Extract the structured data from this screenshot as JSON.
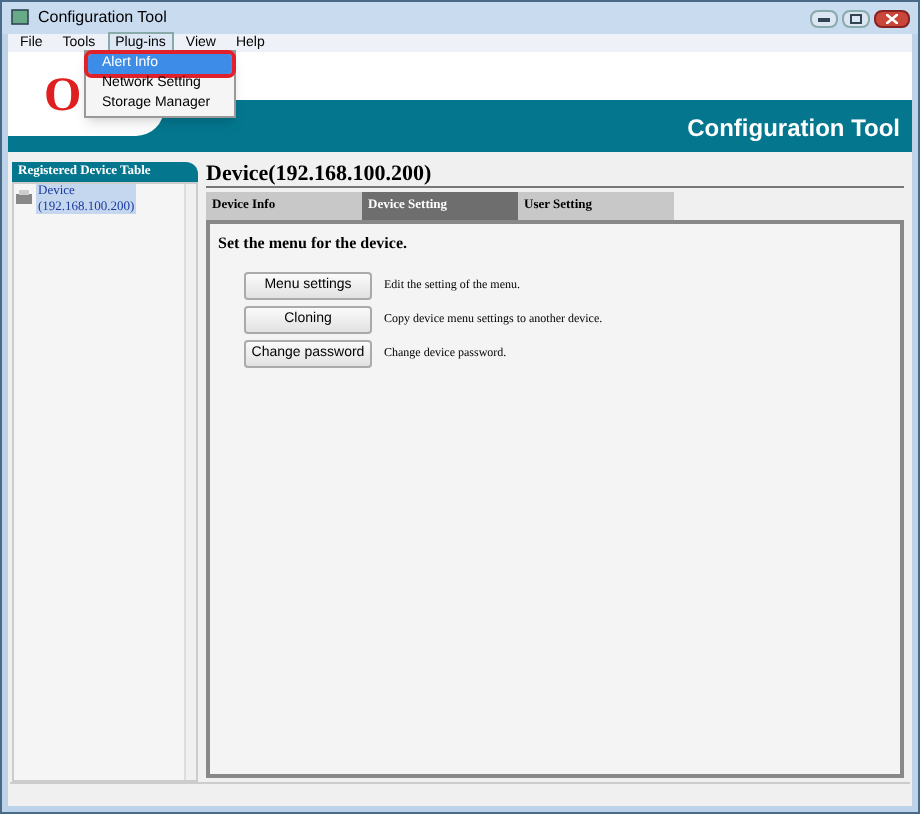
{
  "window": {
    "title": "Configuration Tool"
  },
  "menu_bar": [
    {
      "label": "File",
      "selected": false
    },
    {
      "label": "Tools",
      "selected": false
    },
    {
      "label": "Plug-ins",
      "selected": true
    },
    {
      "label": "View",
      "selected": false
    },
    {
      "label": "Help",
      "selected": false
    }
  ],
  "dropdown": [
    {
      "label": "Alert Info",
      "selected": true
    },
    {
      "label": "Network Setting",
      "selected": false
    },
    {
      "label": "Storage Manager",
      "selected": false
    }
  ],
  "header": {
    "logo": "O",
    "title": "Configuration Tool"
  },
  "sidebar": {
    "title": "Registered Device Table",
    "items": [
      {
        "name": "Device",
        "address": "(192.168.100.200)",
        "selected": true
      }
    ]
  },
  "main": {
    "title": "Device(192.168.100.200)",
    "tabs": [
      {
        "label": "Device Info",
        "selected": false
      },
      {
        "label": "Device Setting",
        "selected": true
      },
      {
        "label": "User Setting",
        "selected": false
      }
    ],
    "heading": "Set the menu for the device.",
    "actions": [
      {
        "button": "Menu settings",
        "description": "Edit the setting of the menu."
      },
      {
        "button": "Cloning",
        "description": "Copy device menu settings to another device."
      },
      {
        "button": "Change password",
        "description": "Change device password."
      }
    ]
  }
}
